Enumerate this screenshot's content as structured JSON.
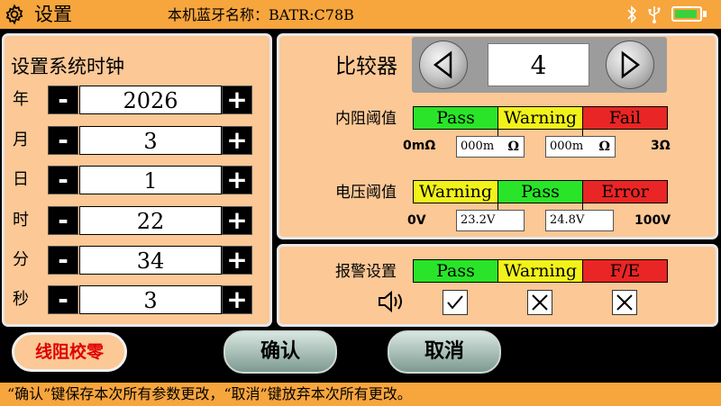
{
  "header": {
    "title": "设置",
    "bluetooth_name": "本机蓝牙名称：BATR:C78B",
    "icons": [
      "gear-icon",
      "bluetooth-icon",
      "usb-icon",
      "battery-icon"
    ],
    "battery_level": 0.85
  },
  "clock": {
    "title": "设置系统时钟",
    "rows": [
      {
        "label": "年",
        "value": "2026"
      },
      {
        "label": "月",
        "value": "3"
      },
      {
        "label": "日",
        "value": "1"
      },
      {
        "label": "时",
        "value": "22"
      },
      {
        "label": "分",
        "value": "34"
      },
      {
        "label": "秒",
        "value": "3"
      }
    ],
    "minus": "-",
    "plus": "+"
  },
  "comparator": {
    "label": "比较器",
    "value": "4"
  },
  "resistance": {
    "label": "内阻阈值",
    "segments": [
      "Pass",
      "Warning",
      "Fail"
    ],
    "min": "0mΩ",
    "max": "3Ω",
    "low_value": "000m",
    "high_value": "000m",
    "unit": "Ω"
  },
  "voltage": {
    "label": "电压阈值",
    "segments": [
      "Warning",
      "Pass",
      "Error"
    ],
    "min": "0V",
    "max": "100V",
    "low_value": "23.2V",
    "high_value": "24.8V"
  },
  "alarm": {
    "label": "报警设置",
    "segments": [
      "Pass",
      "Warning",
      "F/E"
    ],
    "checks": [
      "✓",
      "✕",
      "✕"
    ]
  },
  "buttons": {
    "zero": "线阻校零",
    "ok": "确认",
    "cancel": "取消"
  },
  "footer": "“确认”键保存本次所有参数更改，“取消”键放弃本次所有更改。",
  "colors": {
    "header_bg": "#f7a53d",
    "panel_bg": "#fbc896",
    "green": "#29e429",
    "yellow": "#f2f21b",
    "red": "#ea2525"
  }
}
